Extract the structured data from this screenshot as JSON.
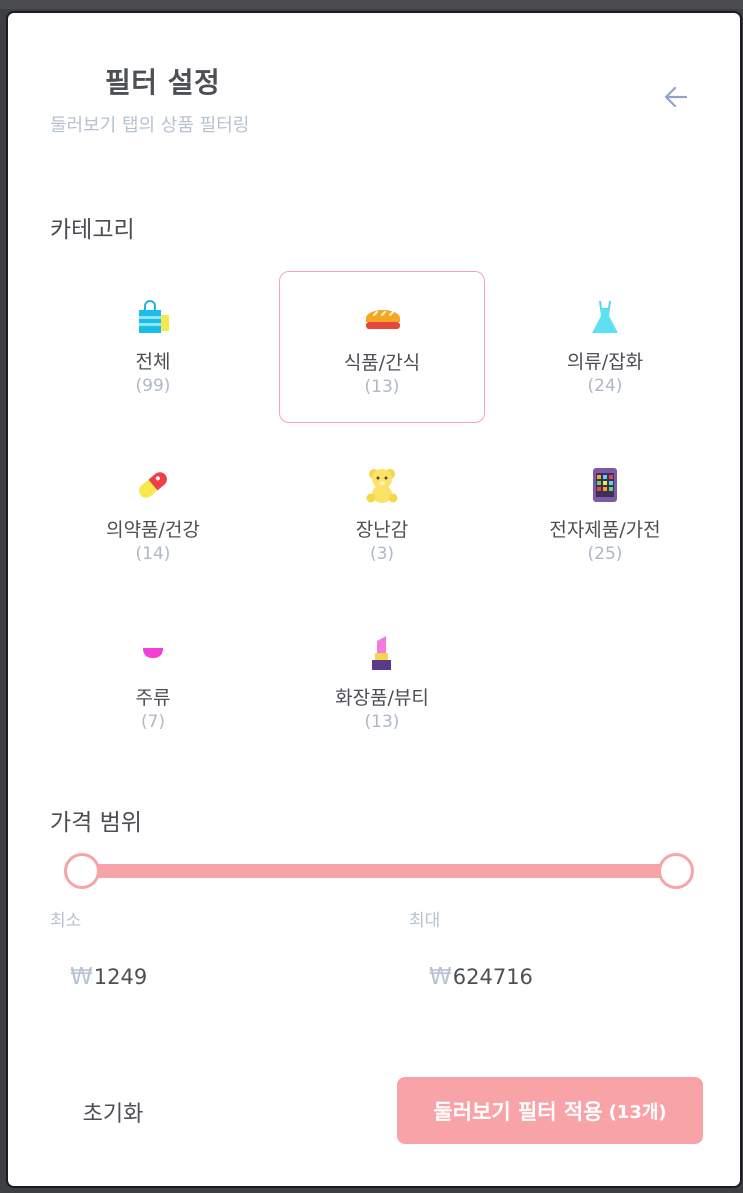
{
  "header": {
    "title": "필터 설정",
    "subtitle": "둘러보기 탭의 상품 필터링",
    "back_icon": "arrow-left-icon"
  },
  "category": {
    "label": "카테고리",
    "selected": "food-snack",
    "items": [
      {
        "id": "all",
        "name": "전체",
        "count": "(99)",
        "icon": "shopping-bag-icon"
      },
      {
        "id": "food-snack",
        "name": "식품/간식",
        "count": "(13)",
        "icon": "bread-icon"
      },
      {
        "id": "clothing",
        "name": "의류/잡화",
        "count": "(24)",
        "icon": "dress-icon"
      },
      {
        "id": "medicine",
        "name": "의약품/건강",
        "count": "(14)",
        "icon": "pill-icon"
      },
      {
        "id": "toys",
        "name": "장난감",
        "count": "(3)",
        "icon": "teddy-bear-icon"
      },
      {
        "id": "electronics",
        "name": "전자제품/가전",
        "count": "(25)",
        "icon": "tablet-icon"
      },
      {
        "id": "liquor",
        "name": "주류",
        "count": "(7)",
        "icon": "wine-glass-icon"
      },
      {
        "id": "beauty",
        "name": "화장품/뷰티",
        "count": "(13)",
        "icon": "lipstick-icon"
      }
    ]
  },
  "price": {
    "label": "가격 범위",
    "min_label": "최소",
    "max_label": "최대",
    "currency": "₩",
    "min_value": "1249",
    "max_value": "624716",
    "slider_min_fraction": 0,
    "slider_max_fraction": 1
  },
  "footer": {
    "reset_label": "초기화",
    "apply_label": "둘러보기 필터 적용",
    "apply_count": "(13개)"
  },
  "colors": {
    "accent": "#f8a3a8",
    "text": "#4c4f54",
    "muted": "#b7c2d0"
  }
}
